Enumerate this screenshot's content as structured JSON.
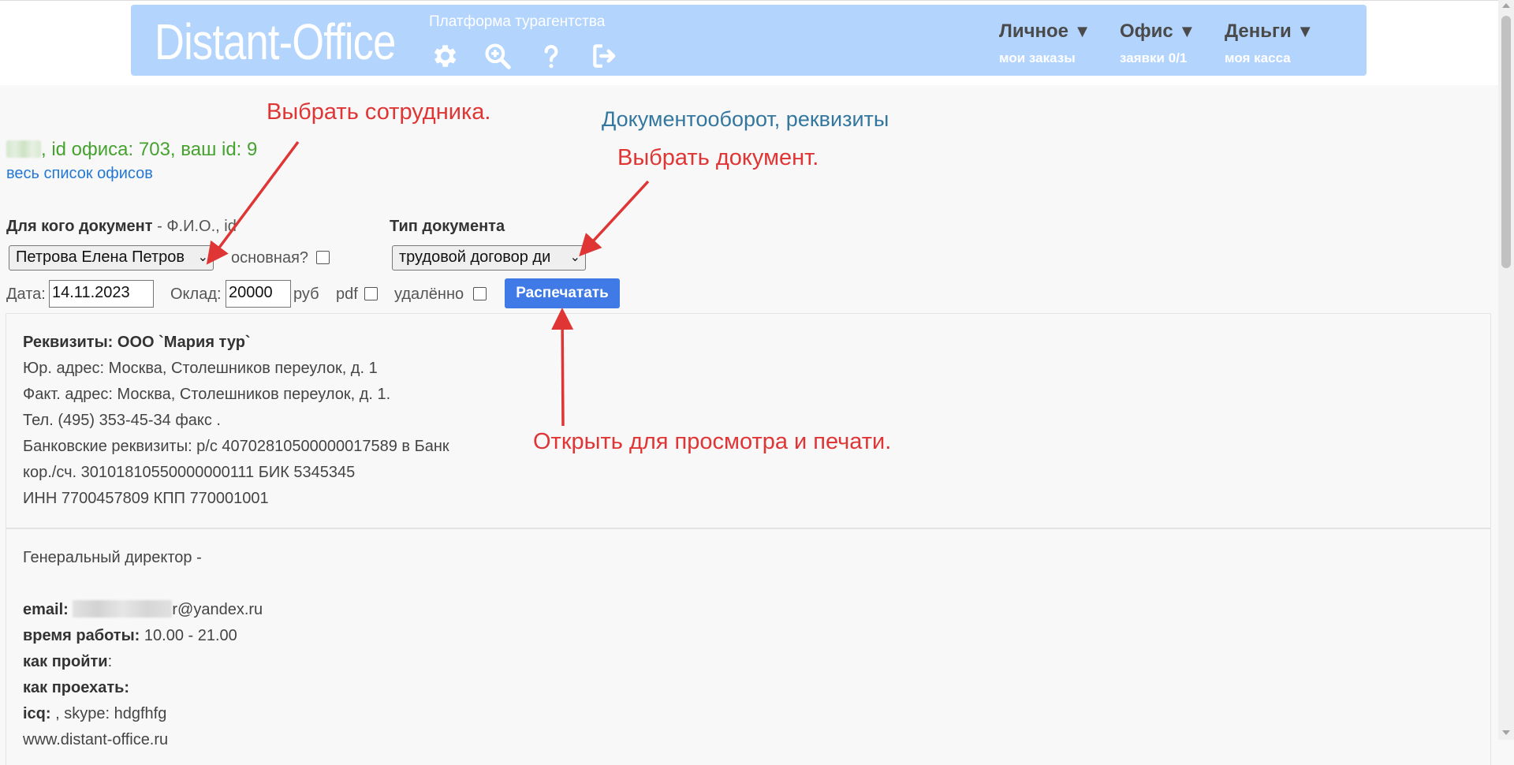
{
  "header": {
    "logo": "Distant-Office",
    "tagline": "Платформа турагентства",
    "icons": [
      "gear-icon",
      "search-plus-icon",
      "question-icon",
      "logout-icon"
    ],
    "nav": [
      {
        "title": "Личное",
        "arrow": "▼",
        "sub": "мои заказы"
      },
      {
        "title": "Офис",
        "arrow": "▼",
        "sub": "заявки 0/1"
      },
      {
        "title": "Деньги",
        "arrow": "▼",
        "sub": "моя касса"
      }
    ],
    "background": "#b3d4fd"
  },
  "annotations": {
    "choose_employee": "Выбрать сотрудника.",
    "choose_document": "Выбрать документ.",
    "open_print": "Открыть для просмотра и печати.",
    "color": "#e03535"
  },
  "doc_link": "Документооборот, реквизиты",
  "office": {
    "info": ", id офиса: 703, ваш id: 9",
    "list_link": "весь список офисов"
  },
  "form": {
    "for_whom_label": "Для кого документ",
    "for_whom_hint": " - Ф.И.О., id",
    "employee_selected": "Петрова Елена Петров",
    "main_label": "основная?",
    "doc_type_label": "Тип документа",
    "doc_type_selected": "трудовой договор ди",
    "date_label": "Дата:",
    "date_value": "14.11.2023",
    "salary_label": "Оклад:",
    "salary_value": "20000",
    "currency": "руб",
    "pdf_label": "pdf",
    "remote_label": "удалённо",
    "print_button": "Распечатать",
    "button_color": "#3f7ae6"
  },
  "requisites": {
    "title": "Реквизиты: ООО `Мария тур`",
    "lines": [
      "Юр. адрес: Москва, Столешников переулок, д. 1",
      "Факт. адрес: Москва, Столешников переулок, д. 1.",
      "Тел. (495) 353-45-34 факс .",
      "Банковские реквизиты: р/с 40702810500000017589 в Банк",
      "кор./сч. 30101810550000000111 БИК 5345345",
      "ИНН 7700457809 КПП 770001001"
    ]
  },
  "contacts": {
    "director": "Генеральный директор -",
    "email_label": "email:",
    "email_suffix": "r@yandex.ru",
    "hours_label": "время работы:",
    "hours_value": " 10.00 - 21.00",
    "how_walk_label": "как пройти",
    "how_walk_value": ":",
    "how_drive_label": "как проехать:",
    "icq_label": "icq:",
    "icq_value": " , skype: hdgfhfg",
    "site": "www.distant-office.ru"
  }
}
